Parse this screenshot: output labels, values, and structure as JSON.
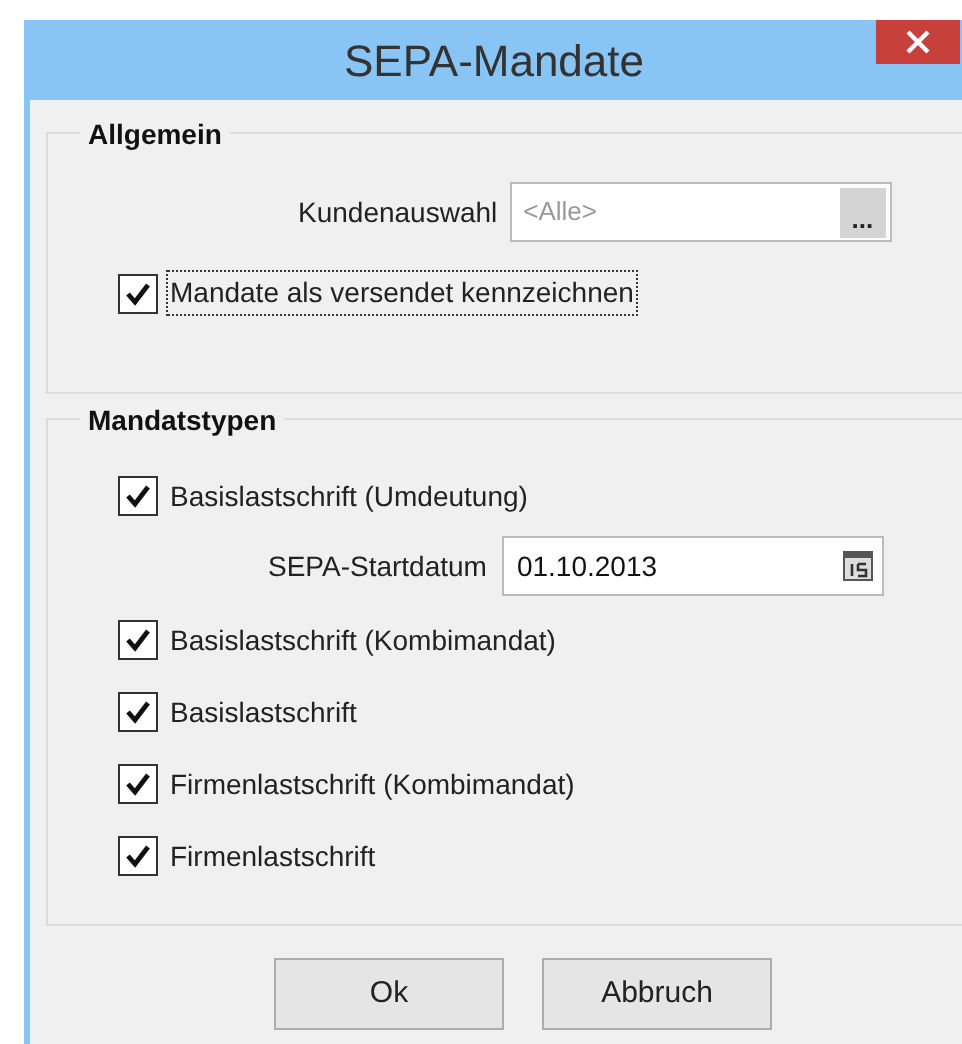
{
  "window": {
    "title": "SEPA-Mandate"
  },
  "general": {
    "title": "Allgemein",
    "customer_label": "Kundenauswahl",
    "customer_placeholder": "<Alle>",
    "browse_button": "...",
    "mark_sent": {
      "label": "Mandate als versendet kennzeichnen",
      "checked": true
    }
  },
  "types": {
    "title": "Mandatstypen",
    "items": [
      {
        "kind": "checkbox",
        "label": "Basislastschrift (Umdeutung)",
        "checked": true
      },
      {
        "kind": "date",
        "label": "SEPA-Startdatum",
        "value": "01.10.2013"
      },
      {
        "kind": "checkbox",
        "label": "Basislastschrift (Kombimandat)",
        "checked": true
      },
      {
        "kind": "checkbox",
        "label": "Basislastschrift",
        "checked": true
      },
      {
        "kind": "checkbox",
        "label": "Firmenlastschrift (Kombimandat)",
        "checked": true
      },
      {
        "kind": "checkbox",
        "label": "Firmenlastschrift",
        "checked": true
      }
    ]
  },
  "buttons": [
    "Ok",
    "Abbruch"
  ]
}
